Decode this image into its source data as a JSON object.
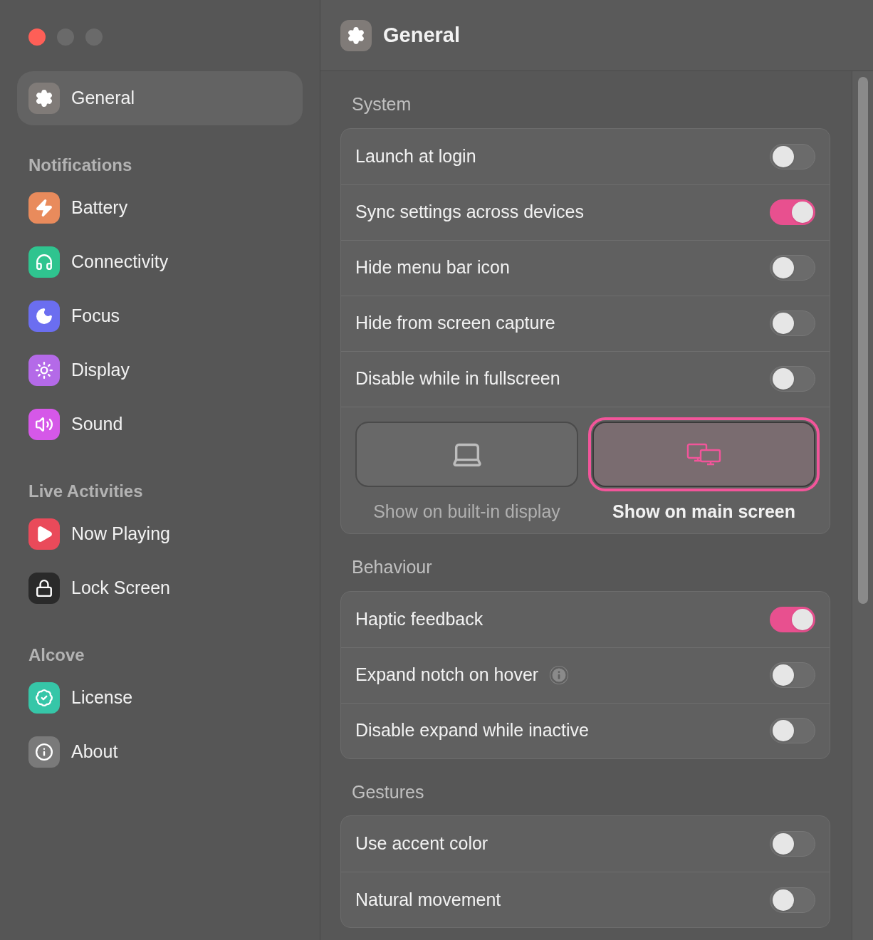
{
  "window": {
    "title": "General"
  },
  "sidebar": {
    "top_item": {
      "label": "General",
      "selected": true,
      "color": "#807b78"
    },
    "sections": [
      {
        "title": "Notifications",
        "items": [
          {
            "label": "Battery",
            "selected": false,
            "color": "#e98b5c"
          },
          {
            "label": "Connectivity",
            "selected": false,
            "color": "#2fc48f"
          },
          {
            "label": "Focus",
            "selected": false,
            "color": "#6b6ef0"
          },
          {
            "label": "Display",
            "selected": false,
            "color": "#b46ae8"
          },
          {
            "label": "Sound",
            "selected": false,
            "color": "#d558e8"
          }
        ]
      },
      {
        "title": "Live Activities",
        "items": [
          {
            "label": "Now Playing",
            "selected": false,
            "color": "#ea4a5a"
          },
          {
            "label": "Lock Screen",
            "selected": false,
            "color": "#2a2a2a"
          }
        ]
      },
      {
        "title": "Alcove",
        "items": [
          {
            "label": "License",
            "selected": false,
            "color": "#36c6a8"
          },
          {
            "label": "About",
            "selected": false,
            "color": "#7a7a7a"
          }
        ]
      }
    ]
  },
  "sections": [
    {
      "title": "System",
      "rows": [
        {
          "label": "Launch at login",
          "on": false,
          "info": false
        },
        {
          "label": "Sync settings across devices",
          "on": true,
          "info": false
        },
        {
          "label": "Hide menu bar icon",
          "on": false,
          "info": false
        },
        {
          "label": "Hide from screen capture",
          "on": false,
          "info": false
        },
        {
          "label": "Disable while in fullscreen",
          "on": false,
          "info": false
        }
      ],
      "display_options": [
        {
          "kind": "laptop",
          "label": "Show on built-in display",
          "selected": false
        },
        {
          "kind": "monitors",
          "label": "Show on main screen",
          "selected": true
        }
      ]
    },
    {
      "title": "Behaviour",
      "rows": [
        {
          "label": "Haptic feedback",
          "on": true,
          "info": false
        },
        {
          "label": "Expand notch on hover",
          "on": false,
          "info": true
        },
        {
          "label": "Disable expand while inactive",
          "on": false,
          "info": false
        }
      ]
    },
    {
      "title": "Gestures",
      "rows": [
        {
          "label": "Use accent color",
          "on": false,
          "info": false
        },
        {
          "label": "Natural movement",
          "on": false,
          "info": false
        }
      ]
    }
  ]
}
